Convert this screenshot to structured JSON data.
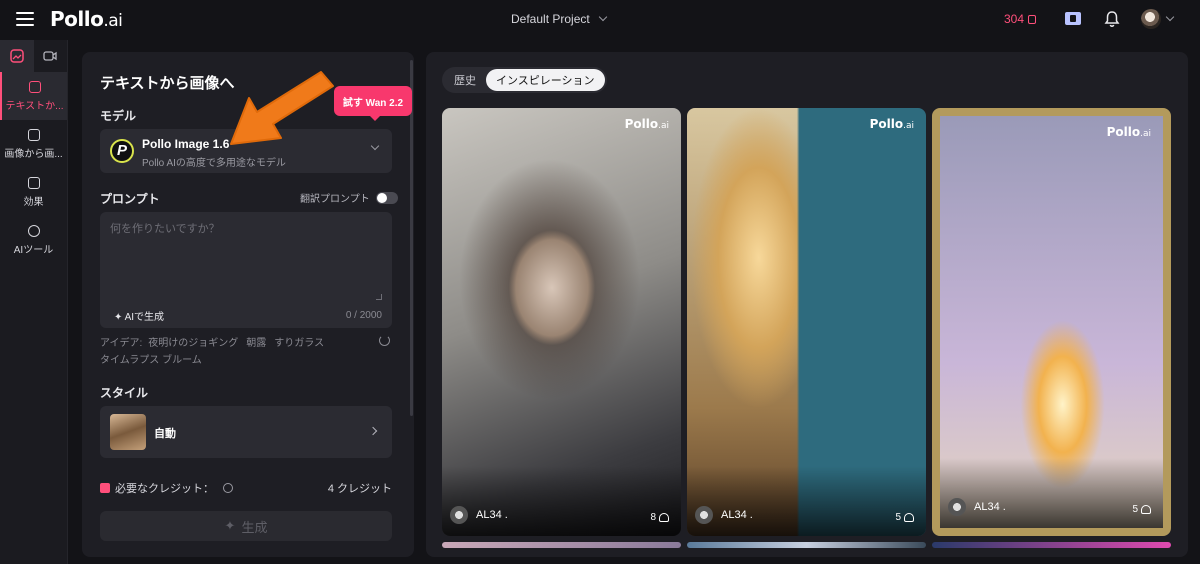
{
  "header": {
    "logo_main": "Pollo",
    "logo_suffix": ".ai",
    "project": "Default Project",
    "credits": "304"
  },
  "sidebar": {
    "items": [
      {
        "label": "テキストか..."
      },
      {
        "label": "画像から画..."
      },
      {
        "label": "効果"
      },
      {
        "label": "AIツール"
      }
    ]
  },
  "panel": {
    "title": "テキストから画像へ",
    "model_label": "モデル",
    "model_name": "Pollo Image 1.6",
    "model_desc": "Pollo AIの高度で多用途なモデル",
    "prompt_label": "プロンプト",
    "translate_label": "翻訳プロンプト",
    "prompt_placeholder": "何を作りたいですか？",
    "ai_generate": "AIで生成",
    "counter": "0 / 2000",
    "ideas_label": "アイデア:",
    "ideas": [
      "夜明けのジョギング",
      "朝露",
      "すりガラス",
      "タイムラプス ブルーム"
    ],
    "style_label": "スタイル",
    "style_value": "自動",
    "required_credits_label": "必要なクレジット：",
    "required_credits_value": "4 クレジット",
    "generate_button": "生成"
  },
  "tooltip": {
    "text": "試す Wan 2.2"
  },
  "gallery": {
    "tabs": [
      {
        "label": "歴史",
        "active": false
      },
      {
        "label": "インスピレーション",
        "active": true
      }
    ],
    "watermark_main": "Pollo",
    "watermark_suffix": ".ai",
    "cards": [
      {
        "user": "AL34 .",
        "likes": "8"
      },
      {
        "user": "AL34 .",
        "likes": "5"
      },
      {
        "user": "AL34 .",
        "likes": "5"
      }
    ]
  },
  "colors": {
    "accent": "#ff4f7b",
    "tooltip": "#f8386d",
    "arrow": "#f07a1a"
  }
}
